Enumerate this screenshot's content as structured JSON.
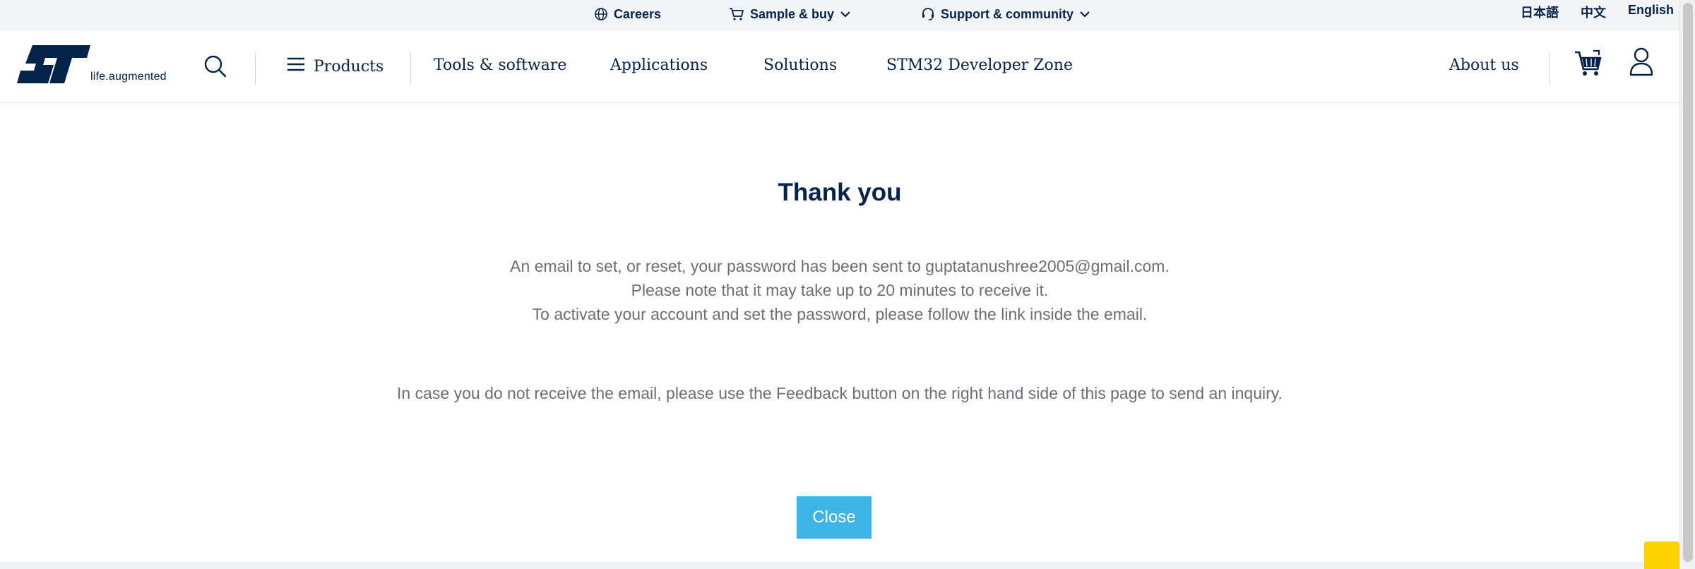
{
  "topbar": {
    "careers": "Careers",
    "sample_buy": "Sample & buy",
    "support": "Support & community",
    "languages": [
      "日本語",
      "中文",
      "English"
    ]
  },
  "header": {
    "logo_tagline": "life.augmented",
    "nav": {
      "products": "Products",
      "tools": "Tools & software",
      "applications": "Applications",
      "solutions": "Solutions",
      "stm32": "STM32 Developer Zone",
      "about": "About us"
    }
  },
  "main": {
    "title": "Thank you",
    "lines": [
      "An email to set, or reset, your password has been sent to guptatanushree2005@gmail.com.",
      "Please note that it may take up to 20 minutes to receive it.",
      "To activate your account and set the password, please follow the link inside the email.",
      "In case you do not receive the email, please use the Feedback button on the right hand side of this page to send an inquiry."
    ],
    "close_label": "Close"
  },
  "colors": {
    "brand_dark": "#03234b",
    "button_blue": "#3cb4e6",
    "feedback_yellow": "#ffd200",
    "text_gray": "#6b6f74"
  },
  "icons": [
    "globe-icon",
    "cart-small-icon",
    "chevron-down-icon",
    "headset-icon",
    "search-icon",
    "menu-icon",
    "cart-icon",
    "user-icon"
  ]
}
